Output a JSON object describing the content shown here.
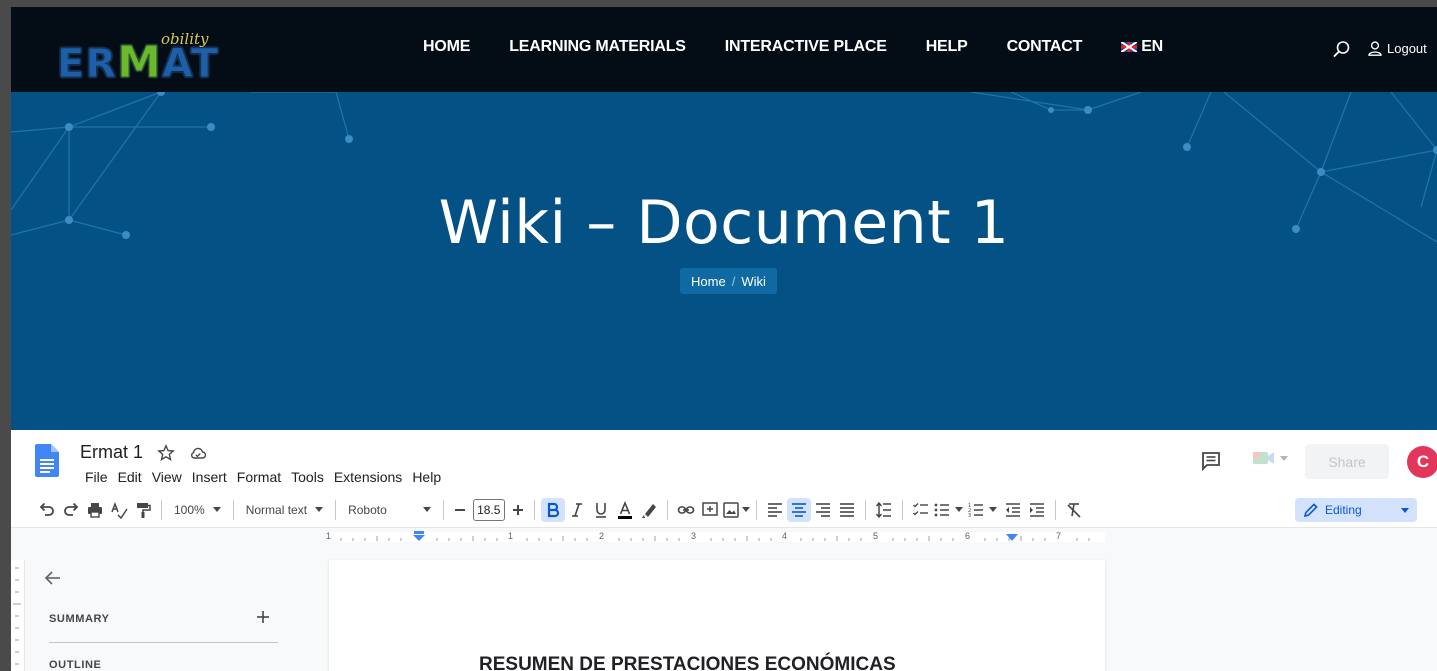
{
  "site": {
    "logo_main_1": "ER",
    "logo_main_2": "M",
    "logo_main_3": "AT",
    "logo_sup": "obility",
    "nav": [
      "HOME",
      "LEARNING MATERIALS",
      "INTERACTIVE PLACE",
      "HELP",
      "CONTACT"
    ],
    "lang": "EN",
    "logout": "Logout"
  },
  "hero": {
    "title": "Wiki – Document 1",
    "breadcrumb": [
      "Home",
      "Wiki"
    ],
    "breadcrumb_sep": "/"
  },
  "docs": {
    "title": "Ermat 1",
    "menu": [
      "File",
      "Edit",
      "View",
      "Insert",
      "Format",
      "Tools",
      "Extensions",
      "Help"
    ],
    "share": "Share",
    "avatar_initial": "C",
    "toolbar": {
      "zoom": "100%",
      "style": "Normal text",
      "font": "Roboto",
      "font_size": "18.5",
      "editing": "Editing"
    },
    "ruler_numbers": [
      "1",
      "1",
      "2",
      "3",
      "4",
      "5",
      "6",
      "7"
    ],
    "outline": {
      "summary": "SUMMARY",
      "outline": "OUTLINE"
    },
    "page_heading": "RESUMEN DE PRESTACIONES ECONÓMICAS"
  },
  "colors": {
    "nav_bg": "#040c15",
    "hero_bg": "#045285",
    "docs_blue": "#0b57d0",
    "avatar": "#e2365a"
  }
}
